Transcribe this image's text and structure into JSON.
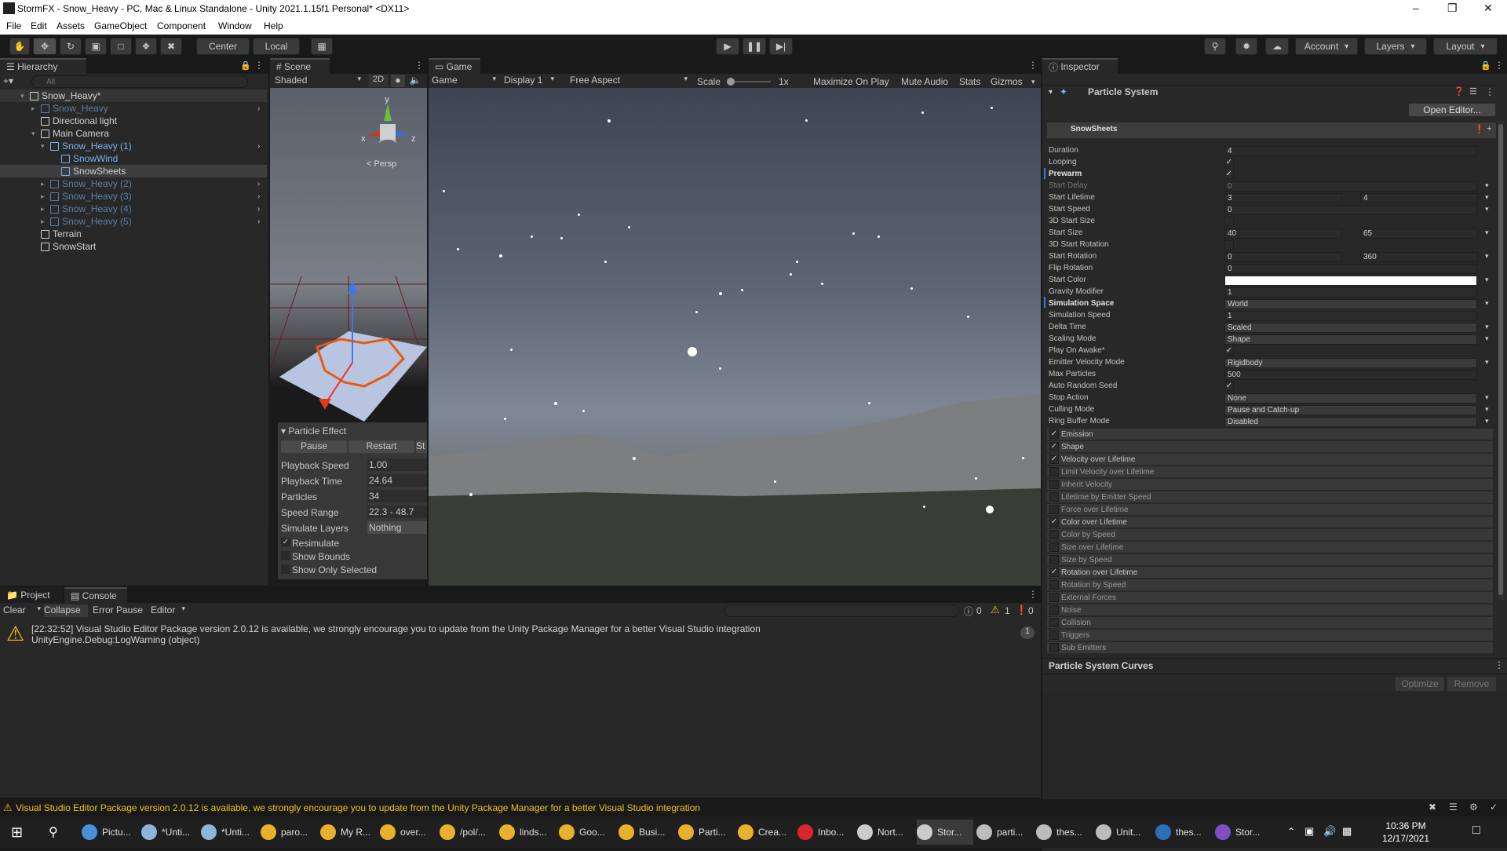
{
  "window": {
    "title": "StormFX - Snow_Heavy - PC, Mac & Linux Standalone - Unity 2021.1.15f1 Personal* <DX11>"
  },
  "menu": [
    "File",
    "Edit",
    "Assets",
    "GameObject",
    "Component",
    "Window",
    "Help"
  ],
  "toolbar": {
    "center": "Center",
    "local": "Local",
    "account": "Account",
    "layers": "Layers",
    "layout": "Layout"
  },
  "hierarchy": {
    "tab": "Hierarchy",
    "search_placeholder": "All",
    "items": [
      {
        "label": "Snow_Heavy*",
        "style": "root"
      },
      {
        "label": "Snow_Heavy",
        "style": "dim"
      },
      {
        "label": "Directional light",
        "style": "normal"
      },
      {
        "label": "Main Camera",
        "style": "normal"
      },
      {
        "label": "Snow_Heavy (1)",
        "style": "blue"
      },
      {
        "label": "SnowWind",
        "style": "blue"
      },
      {
        "label": "SnowSheets",
        "style": "selected"
      },
      {
        "label": "Snow_Heavy (2)",
        "style": "dim"
      },
      {
        "label": "Snow_Heavy (3)",
        "style": "dim"
      },
      {
        "label": "Snow_Heavy (4)",
        "style": "dim"
      },
      {
        "label": "Snow_Heavy (5)",
        "style": "dim"
      },
      {
        "label": "Terrain",
        "style": "normal"
      },
      {
        "label": "SnowStart",
        "style": "normal"
      }
    ]
  },
  "scene": {
    "tab": "Scene",
    "shading": "Shaded",
    "mode2d": "2D",
    "persp": "< Persp",
    "gizmo_y": "y",
    "gizmo_x": "x",
    "gizmo_z": "z"
  },
  "particle_effect": {
    "title": "Particle Effect",
    "pause": "Pause",
    "restart": "Restart",
    "stop": "St",
    "rows": [
      {
        "label": "Playback Speed",
        "value": "1.00"
      },
      {
        "label": "Playback Time",
        "value": "24.64"
      },
      {
        "label": "Particles",
        "value": "34"
      },
      {
        "label": "Speed Range",
        "value": "22.3 - 48.7"
      },
      {
        "label": "Simulate Layers",
        "value": "Nothing"
      }
    ],
    "checks": [
      {
        "label": "Resimulate",
        "checked": "✓"
      },
      {
        "label": "Show Bounds",
        "checked": ""
      },
      {
        "label": "Show Only Selected",
        "checked": ""
      }
    ]
  },
  "game": {
    "tab": "Game",
    "mode": "Game",
    "display": "Display 1",
    "aspect": "Free Aspect",
    "scale_label": "Scale",
    "scale_value": "1x",
    "maximize": "Maximize On Play",
    "mute": "Mute Audio",
    "stats": "Stats",
    "gizmos": "Gizmos"
  },
  "inspector": {
    "tab": "Inspector",
    "component": "Particle System",
    "open_editor": "Open Editor...",
    "system_name": "SnowSheets",
    "props": [
      {
        "label": "Duration",
        "v1": "4"
      },
      {
        "label": "Looping",
        "check": "✓"
      },
      {
        "label": "Prewarm",
        "check": "✓",
        "bold": true
      },
      {
        "label": "Start Delay",
        "v1": "0",
        "dim": true
      },
      {
        "label": "Start Lifetime",
        "v1": "3",
        "v2": "4"
      },
      {
        "label": "Start Speed",
        "v1": "0"
      },
      {
        "label": "3D Start Size",
        "check": ""
      },
      {
        "label": "Start Size",
        "v1": "40",
        "v2": "65"
      },
      {
        "label": "3D Start Rotation",
        "check": ""
      },
      {
        "label": "Start Rotation",
        "v1": "0",
        "v2": "360"
      },
      {
        "label": "Flip Rotation",
        "v1": "0"
      },
      {
        "label": "Start Color",
        "color": "#ffffff"
      },
      {
        "label": "Gravity Modifier",
        "v1": "1"
      },
      {
        "label": "Simulation Space",
        "v1": "World",
        "bold": true
      },
      {
        "label": "Simulation Speed",
        "v1": "1"
      },
      {
        "label": "Delta Time",
        "v1": "Scaled"
      },
      {
        "label": "Scaling Mode",
        "v1": "Shape"
      },
      {
        "label": "Play On Awake*",
        "check": "✓"
      },
      {
        "label": "Emitter Velocity Mode",
        "v1": "Rigidbody"
      },
      {
        "label": "Max Particles",
        "v1": "500"
      },
      {
        "label": "Auto Random Seed",
        "check": "✓"
      },
      {
        "label": "Stop Action",
        "v1": "None"
      },
      {
        "label": "Culling Mode",
        "v1": "Pause and Catch-up"
      },
      {
        "label": "Ring Buffer Mode",
        "v1": "Disabled"
      }
    ],
    "modules": [
      {
        "label": "Emission",
        "check": "✓"
      },
      {
        "label": "Shape",
        "check": "✓"
      },
      {
        "label": "Velocity over Lifetime",
        "check": "✓"
      },
      {
        "label": "Limit Velocity over Lifetime",
        "check": ""
      },
      {
        "label": "Inherit Velocity",
        "check": ""
      },
      {
        "label": "Lifetime by Emitter Speed",
        "check": ""
      },
      {
        "label": "Force over Lifetime",
        "check": ""
      },
      {
        "label": "Color over Lifetime",
        "check": "✓"
      },
      {
        "label": "Color by Speed",
        "check": ""
      },
      {
        "label": "Size over Lifetime",
        "check": ""
      },
      {
        "label": "Size by Speed",
        "check": ""
      },
      {
        "label": "Rotation over Lifetime",
        "check": "✓"
      },
      {
        "label": "Rotation by Speed",
        "check": ""
      },
      {
        "label": "External Forces",
        "check": ""
      },
      {
        "label": "Noise",
        "check": ""
      },
      {
        "label": "Collision",
        "check": ""
      },
      {
        "label": "Triggers",
        "check": ""
      },
      {
        "label": "Sub Emitters",
        "check": ""
      }
    ],
    "curves_title": "Particle System Curves",
    "optimize": "Optimize",
    "remove": "Remove"
  },
  "console": {
    "tabs": [
      "Project",
      "Console"
    ],
    "clear": "Clear",
    "collapse": "Collapse",
    "error_pause": "Error Pause",
    "editor": "Editor",
    "count_info": "0",
    "count_warn": "1",
    "count_err": "0",
    "message_line1": "[22:32:52] Visual Studio Editor Package version 2.0.12 is available, we strongly encourage you to update from the Unity Package Manager for a better Visual Studio integration",
    "message_line2": "UnityEngine.Debug:LogWarning (object)",
    "message_count": "1"
  },
  "statusbar": {
    "message": "Visual Studio Editor Package version 2.0.12 is available, we strongly encourage you to update from the Unity Package Manager for a better Visual Studio integration"
  },
  "taskbar": {
    "items": [
      {
        "label": "Pictu...",
        "color": "#4a90d9"
      },
      {
        "label": "*Unti...",
        "color": "#8fb3d9"
      },
      {
        "label": "*Unti...",
        "color": "#8fb3d9"
      },
      {
        "label": "paro...",
        "color": "#e8b02c"
      },
      {
        "label": "My R...",
        "color": "#e8b02c"
      },
      {
        "label": "over...",
        "color": "#e8b02c"
      },
      {
        "label": "/pol/...",
        "color": "#e8b02c"
      },
      {
        "label": "linds...",
        "color": "#e8b02c"
      },
      {
        "label": "Goo...",
        "color": "#e8b02c"
      },
      {
        "label": "Busi...",
        "color": "#e8b02c"
      },
      {
        "label": "Parti...",
        "color": "#e8b02c"
      },
      {
        "label": "Crea...",
        "color": "#e8b02c"
      },
      {
        "label": "Inbo...",
        "color": "#d9262e"
      },
      {
        "label": "Nort...",
        "color": "#cccccc"
      },
      {
        "label": "Stor...",
        "color": "#cccccc"
      },
      {
        "label": "parti...",
        "color": "#bcbcbc"
      },
      {
        "label": "thes...",
        "color": "#bcbcbc"
      },
      {
        "label": "Unit...",
        "color": "#bcbcbc"
      },
      {
        "label": "thes...",
        "color": "#2c6fb8"
      },
      {
        "label": "Stor...",
        "color": "#7d4fc2"
      }
    ],
    "time": "10:36 PM",
    "date": "12/17/2021"
  }
}
